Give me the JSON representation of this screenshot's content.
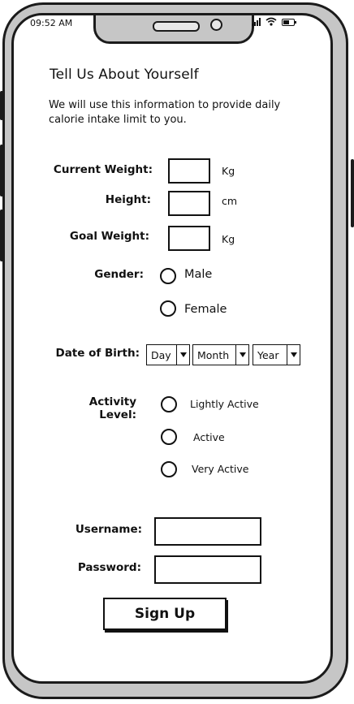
{
  "status_bar": {
    "time": "09:52 AM"
  },
  "page": {
    "title": "Tell Us About Yourself",
    "subtitle": "We will use this information to provide daily calorie intake limit to you."
  },
  "form": {
    "current_weight": {
      "label": "Current Weight:",
      "unit": "Kg",
      "value": ""
    },
    "height": {
      "label": "Height:",
      "unit": "cm",
      "value": ""
    },
    "goal_weight": {
      "label": "Goal Weight:",
      "unit": "Kg",
      "value": ""
    },
    "gender": {
      "label": "Gender:",
      "options": [
        "Male",
        "Female"
      ]
    },
    "dob": {
      "label": "Date of Birth:",
      "day": "Day",
      "month": "Month",
      "year": "Year"
    },
    "activity": {
      "label": "Activity Level:",
      "options": [
        "Lightly Active",
        "Active",
        "Very Active"
      ]
    },
    "username": {
      "label": "Username:",
      "value": ""
    },
    "password": {
      "label": "Password:",
      "value": ""
    },
    "signup_label": "Sign Up"
  },
  "icons": {
    "signal": "cellular-signal-icon",
    "wifi": "wifi-icon",
    "battery": "battery-icon",
    "dropdown": "chevron-down-icon"
  }
}
